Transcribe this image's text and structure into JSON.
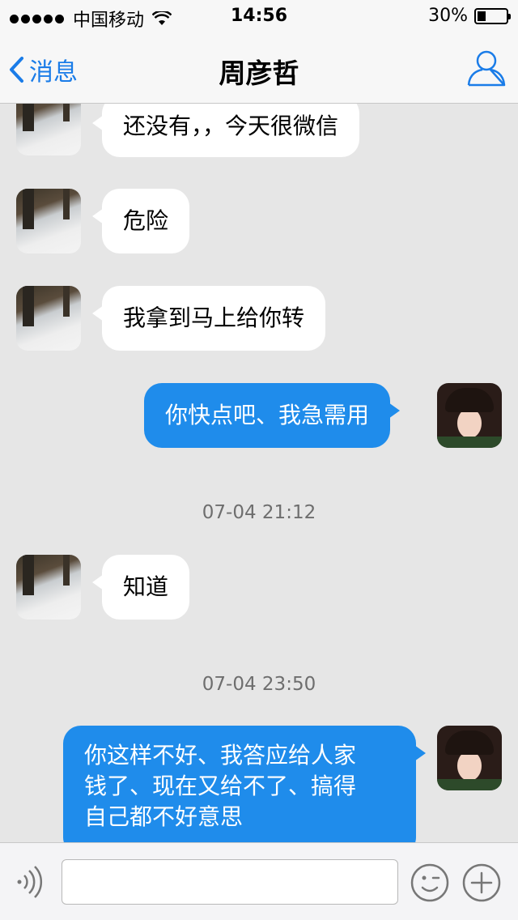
{
  "status_bar": {
    "carrier": "中国移动",
    "time": "14:56",
    "battery_percent": "30%",
    "battery_level": 0.3,
    "signal_bars": 5,
    "wifi_icon": "wifi-icon"
  },
  "nav": {
    "back_label": "消息",
    "title": "周彦哲",
    "profile_icon": "person-icon"
  },
  "messages": [
    {
      "direction": "in",
      "text": "还没有，，今天很微信",
      "avatar": "snow-road-avatar"
    },
    {
      "direction": "in",
      "text": "危险",
      "avatar": "snow-road-avatar"
    },
    {
      "direction": "in",
      "text": "我拿到马上给你转",
      "avatar": "snow-road-avatar"
    },
    {
      "direction": "out",
      "text": "你快点吧、我急需用",
      "avatar": "girl-avatar"
    },
    {
      "direction": "in",
      "text": "知道",
      "avatar": "snow-road-avatar"
    },
    {
      "direction": "out",
      "text": "你这样不好、我答应给人家钱了、现在又给不了、搞得自己都不好意思",
      "avatar": "girl-avatar",
      "lines": [
        "你这样不好、我答应给人家",
        "钱了、现在又给不了、搞得",
        "自己都不好意思"
      ]
    }
  ],
  "timestamps": [
    "07-04 21:12",
    "07-04 23:50"
  ],
  "input_bar": {
    "voice_icon": "voice-icon",
    "input_value": "",
    "emoji_icon": "emoji-icon",
    "plus_icon": "plus-icon"
  }
}
